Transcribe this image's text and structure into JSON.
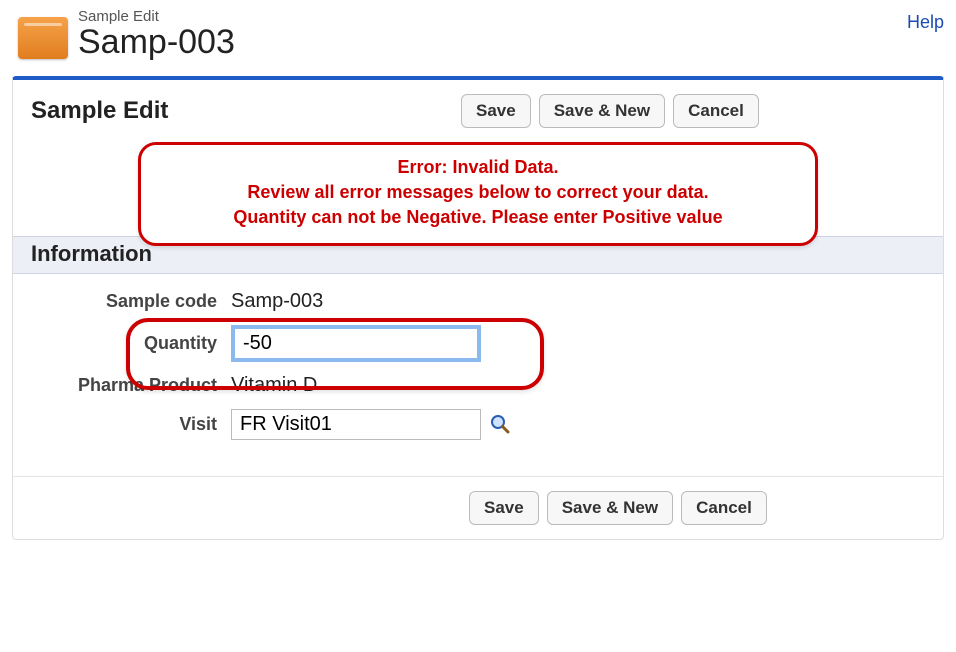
{
  "header": {
    "record_type": "Sample Edit",
    "record_name": "Samp-003",
    "help": "Help"
  },
  "panel": {
    "title": "Sample Edit",
    "buttons": {
      "save": "Save",
      "save_new": "Save & New",
      "cancel": "Cancel"
    }
  },
  "error": {
    "line1": "Error: Invalid Data.",
    "line2": "Review all error messages below to correct your data.",
    "line3": "Quantity can not be Negative. Please enter Positive value"
  },
  "section": {
    "title": "Information"
  },
  "form": {
    "sample_code": {
      "label": "Sample code",
      "value": "Samp-003"
    },
    "quantity": {
      "label": "Quantity",
      "value": "-50"
    },
    "product": {
      "label": "Pharma Product",
      "value": "Vitamin D"
    },
    "visit": {
      "label": "Visit",
      "value": "FR Visit01"
    }
  }
}
